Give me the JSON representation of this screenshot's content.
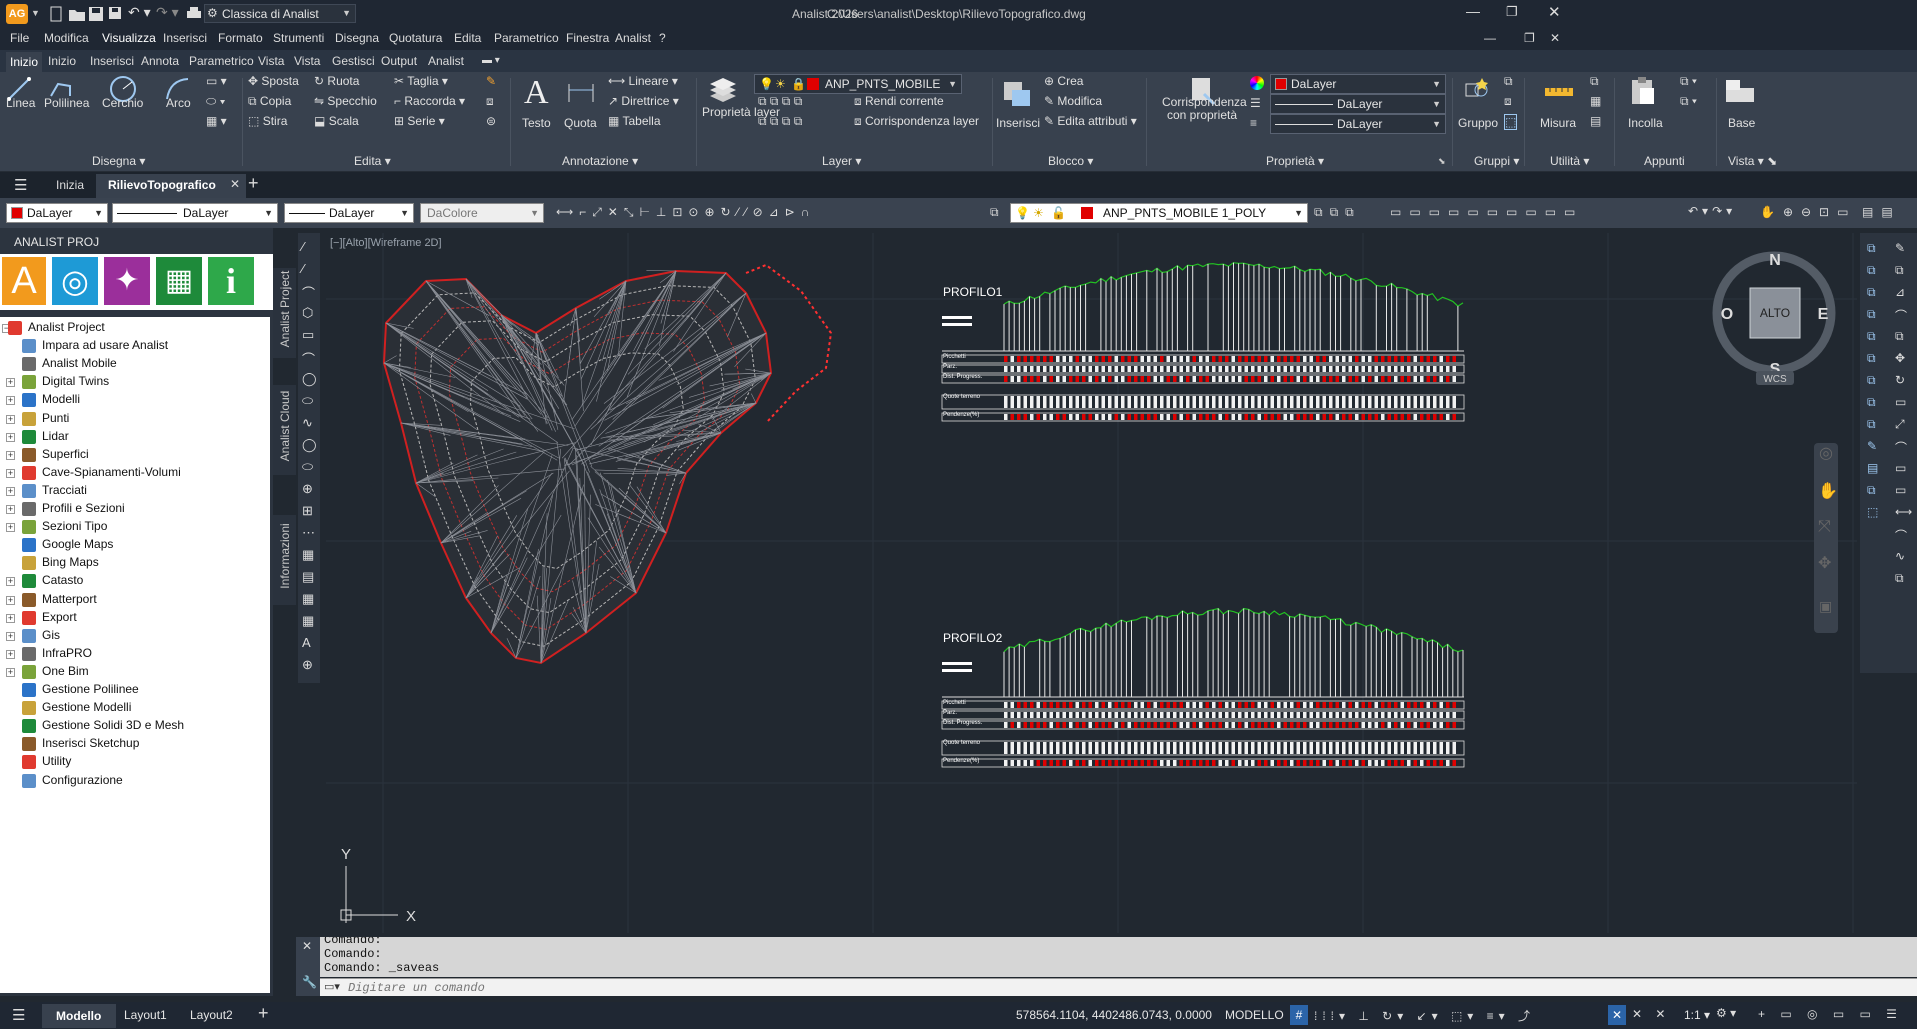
{
  "app": {
    "title": "Analist 2026",
    "file_path": "C:\\Users\\analist\\Desktop\\RilievoTopografico.dwg",
    "workspace": "Classica di Analist",
    "logo": "AG"
  },
  "menus": [
    "File",
    "Modifica",
    "Visualizza",
    "Inserisci",
    "Formato",
    "Strumenti",
    "Disegna",
    "Quotatura",
    "Edita",
    "Parametrico",
    "Finestra",
    "Analist",
    "?"
  ],
  "ribbon_tabs": [
    "Inizio",
    "Inizio",
    "Inserisci",
    "Annota",
    "Parametrico",
    "Vista",
    "Vista",
    "Gestisci",
    "Output",
    "Analist"
  ],
  "ribbon": {
    "disegna": {
      "label": "Disegna",
      "tools": [
        "Linea",
        "Polilinea",
        "Cerchio",
        "Arco"
      ]
    },
    "edita": {
      "label": "Edita",
      "tools": [
        "Sposta",
        "Ruota",
        "Taglia",
        "Copia",
        "Specchio",
        "Raccorda",
        "Stira",
        "Scala",
        "Serie"
      ]
    },
    "annotazione": {
      "label": "Annotazione",
      "tools": [
        "Testo",
        "Quota",
        "Lineare",
        "Direttrice",
        "Tabella"
      ]
    },
    "layer": {
      "label": "Layer",
      "tools": [
        "Proprietà layer",
        "Rendi corrente",
        "Corrispondenza layer"
      ],
      "current": "ANP_PNTS_MOBILE"
    },
    "blocco": {
      "label": "Blocco",
      "tools": [
        "Inserisci",
        "Crea",
        "Modifica",
        "Edita attributi"
      ]
    },
    "proprieta": {
      "label": "Proprietà",
      "tools": [
        "Corrispondenza con proprietà"
      ],
      "color": "DaLayer",
      "linetype": "DaLayer",
      "lineweight": "DaLayer"
    },
    "gruppi": {
      "label": "Gruppi",
      "tools": [
        "Gruppo"
      ]
    },
    "utilita": {
      "label": "Utilità",
      "tools": [
        "Misura"
      ]
    },
    "appunti": {
      "label": "Appunti",
      "tools": [
        "Incolla"
      ]
    },
    "vista": {
      "label": "Vista",
      "tools": [
        "Base"
      ]
    }
  },
  "doc_tabs": [
    "Inizia",
    "RilievoTopografico"
  ],
  "props_bar": {
    "color": "DaLayer",
    "linetype": "DaLayer",
    "lineweight": "DaLayer",
    "plotstyle": "DaColore",
    "layer": "ANP_PNTS_MOBILE 1_POLY"
  },
  "panel": {
    "title": "ANALIST PROJ",
    "tiles": [
      {
        "name": "analist-tile",
        "glyph": "A",
        "color": "#f29a1d"
      },
      {
        "name": "globe-tile",
        "glyph": "◎",
        "color": "#1e9ad6"
      },
      {
        "name": "satellite-tile",
        "glyph": "✦",
        "color": "#9b2f9b"
      },
      {
        "name": "map-tile",
        "glyph": "▦",
        "color": "#1e8a3a"
      },
      {
        "name": "info-tile",
        "glyph": "i",
        "color": "#2ea84a"
      }
    ],
    "tree": [
      {
        "label": "Analist Project",
        "exp": true,
        "root": true
      },
      {
        "label": "Impara ad usare Analist",
        "exp": false
      },
      {
        "label": "Analist Mobile",
        "exp": false
      },
      {
        "label": "Digital Twins",
        "exp": true
      },
      {
        "label": "Modelli",
        "exp": true
      },
      {
        "label": "Punti",
        "exp": true
      },
      {
        "label": "Lidar",
        "exp": true
      },
      {
        "label": "Superfici",
        "exp": true
      },
      {
        "label": "Cave-Spianamenti-Volumi",
        "exp": true
      },
      {
        "label": "Tracciati",
        "exp": true
      },
      {
        "label": "Profili e Sezioni",
        "exp": true
      },
      {
        "label": "Sezioni Tipo",
        "exp": true
      },
      {
        "label": "Google Maps",
        "exp": false
      },
      {
        "label": "Bing Maps",
        "exp": false
      },
      {
        "label": "Catasto",
        "exp": true
      },
      {
        "label": "Matterport",
        "exp": true
      },
      {
        "label": "Export",
        "exp": true
      },
      {
        "label": "Gis",
        "exp": true
      },
      {
        "label": "InfraPRO",
        "exp": true
      },
      {
        "label": "One Bim",
        "exp": true
      },
      {
        "label": "Gestione Polilinee",
        "exp": false
      },
      {
        "label": "Gestione Modelli",
        "exp": false
      },
      {
        "label": "Gestione Solidi 3D e Mesh",
        "exp": false
      },
      {
        "label": "Inserisci Sketchup",
        "exp": false
      },
      {
        "label": "Utility",
        "exp": false
      },
      {
        "label": "Configurazione",
        "exp": false
      }
    ],
    "vtabs": [
      "Analist Project",
      "Analist Cloud",
      "Informazioni"
    ]
  },
  "viewport": {
    "label": "[−][Alto][Wireframe 2D]",
    "compass": {
      "n": "N",
      "s": "S",
      "e": "E",
      "w": "O",
      "center": "ALTO",
      "wcs": "WCS"
    },
    "ucs": {
      "x": "X",
      "y": "Y"
    },
    "profiles": [
      {
        "title": "PROFILO1",
        "rows": [
          "Picchetti",
          "Parz.",
          "Dist. Progress.",
          "Quote terreno",
          "Pendenze(%)"
        ]
      },
      {
        "title": "PROFILO2",
        "rows": [
          "Picchetti",
          "Parz.",
          "Dist. Progress.",
          "Quote terreno",
          "Pendenze(%)"
        ]
      }
    ]
  },
  "command": {
    "lines": [
      "Comando:",
      "Comando:",
      "Comando: _saveas"
    ],
    "placeholder": "Digitare un comando"
  },
  "status": {
    "tabs": [
      "Modello",
      "Layout1",
      "Layout2"
    ],
    "coords": "578564.1104, 4402486.0743, 0.0000",
    "space": "MODELLO",
    "scale": "1:1"
  },
  "colors": {
    "accent": "#e00000",
    "ui_dark": "#212830",
    "ribbon": "#38414e",
    "profile_line": "#22c022"
  }
}
